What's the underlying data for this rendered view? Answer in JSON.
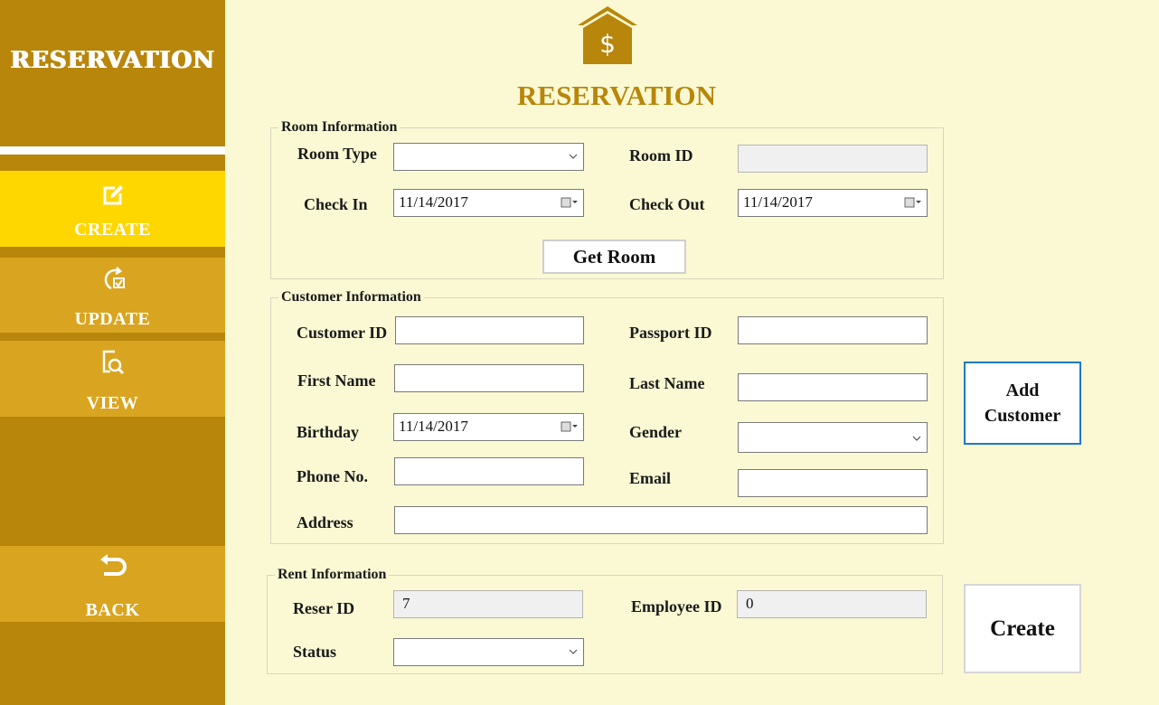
{
  "sidebar": {
    "title": "RESERVATION",
    "items": [
      {
        "label": "CREATE",
        "icon": "edit-icon"
      },
      {
        "label": "UPDATE",
        "icon": "refresh-check-icon"
      },
      {
        "label": "VIEW",
        "icon": "document-search-icon"
      },
      {
        "label": "BACK",
        "icon": "back-arrow-icon"
      }
    ],
    "active": "CREATE"
  },
  "header": {
    "icon": "house-dollar-icon",
    "title": "RESERVATION"
  },
  "room_info": {
    "title": "Room Information",
    "room_type_label": "Room Type",
    "room_type_value": "",
    "room_id_label": "Room ID",
    "room_id_value": "",
    "check_in_label": "Check In",
    "check_in_value": "11/14/2017",
    "check_out_label": "Check Out",
    "check_out_value": "11/14/2017",
    "get_room_label": "Get Room"
  },
  "customer_info": {
    "title": "Customer Information",
    "customer_id_label": "Customer ID",
    "customer_id_value": "",
    "passport_id_label": "Passport ID",
    "passport_id_value": "",
    "first_name_label": "First Name",
    "first_name_value": "",
    "last_name_label": "Last Name",
    "last_name_value": "",
    "birthday_label": "Birthday",
    "birthday_value": "11/14/2017",
    "gender_label": "Gender",
    "gender_value": "",
    "phone_label": "Phone No.",
    "phone_value": "",
    "email_label": "Email",
    "email_value": "",
    "address_label": "Address",
    "address_value": ""
  },
  "add_customer": {
    "line1": "Add",
    "line2": "Customer"
  },
  "rent_info": {
    "title": "Rent Information",
    "reser_id_label": "Reser ID",
    "reser_id_value": "7",
    "employee_id_label": "Employee ID",
    "employee_id_value": "0",
    "status_label": "Status",
    "status_value": ""
  },
  "create_label": "Create",
  "colors": {
    "sidebar": "#b8860b",
    "sidebar_active": "#ffd700",
    "sidebar_button": "#d9a520",
    "background": "#fbf9d3",
    "title": "#b8860b"
  }
}
